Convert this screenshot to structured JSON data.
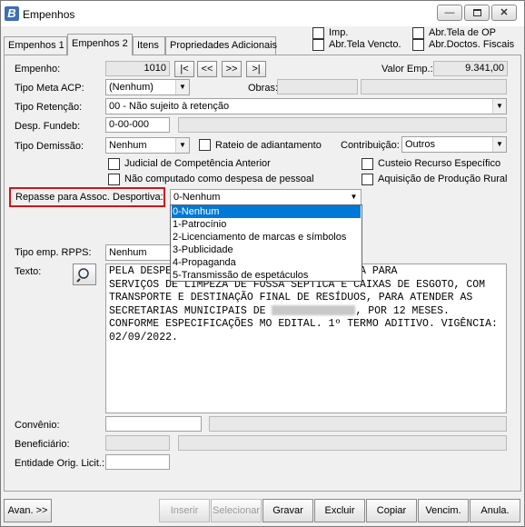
{
  "window": {
    "title": "Empenhos",
    "app_icon": "B"
  },
  "top_checks": [
    {
      "label": "Imp."
    },
    {
      "label": "Abr.Tela Vencto."
    },
    {
      "label": "Abr.Tela de OP"
    },
    {
      "label": "Abr.Doctos. Fiscais"
    }
  ],
  "tabs": [
    "Empenhos 1",
    "Empenhos 2",
    "Itens",
    "Propriedades Adicionais"
  ],
  "form": {
    "empenho_label": "Empenho:",
    "empenho_value": "1010",
    "nav": [
      "|<",
      "<<",
      ">>",
      ">|"
    ],
    "valor_label": "Valor Emp.:",
    "valor_value": "9.341,00",
    "tipo_meta_label": "Tipo Meta ACP:",
    "tipo_meta_value": "(Nenhum)",
    "obras_label": "Obras:",
    "tipo_retencao_label": "Tipo Retenção:",
    "tipo_retencao_value": "00 - Não sujeito à retenção",
    "desp_fundeb_label": "Desp. Fundeb:",
    "desp_fundeb_value": "0-00-000",
    "tipo_demissao_label": "Tipo Demissão:",
    "tipo_demissao_value": "Nenhum",
    "rateio_label": "Rateio de adiantamento",
    "contribuicao_label": "Contribuição:",
    "contribuicao_value": "Outros",
    "judicial_label": "Judicial de Competência Anterior",
    "custeio_label": "Custeio Recurso Específico",
    "nao_computado_label": "Não computado como despesa de pessoal",
    "aquisicao_label": "Aquisição de Produção Rural",
    "repasse_label": "Repasse para Assoc. Desportiva:",
    "repasse_value": "0-Nenhum",
    "repasse_options": [
      "0-Nenhum",
      "1-Patrocínio",
      "2-Licenciamento de marcas e símbolos",
      "3-Publicidade",
      "4-Propaganda",
      "5-Transmissão de espetáculos"
    ],
    "tipo_rpps_label": "Tipo emp. RPPS:",
    "tipo_rpps_value": "Nenhum",
    "texto_label": "Texto:",
    "texto_lines": [
      "PELA DESPESA COM A CONTRATAÇÃO DE EMPRESA PARA",
      "SERVIÇOS DE LIMPEZA DE FOSSA SÉPTICA E CAIXAS DE ESGOTO, COM",
      "TRANSPORTE E DESTINAÇÃO FINAL DE RESÍDUOS, PARA ATENDER AS",
      ", POR 12 MESES.",
      "CONFORME ESPECIFICAÇÕES MO EDITAL. 1º TERMO ADITIVO. VIGÊNCIA:",
      "02/09/2022."
    ],
    "texto_line4_prefix": "SECRETARIAS MUNICIPAIS DE ",
    "convenio_label": "Convênio:",
    "beneficiario_label": "Beneficiário:",
    "entidade_label": "Entidade Orig. Licit.:"
  },
  "buttons": {
    "avan": "Avan. >>",
    "inserir": "Inserir",
    "selecionar": "Selecionar",
    "gravar": "Gravar",
    "excluir": "Excluir",
    "copiar": "Copiar",
    "vencim": "Vencim.",
    "anula": "Anula."
  }
}
